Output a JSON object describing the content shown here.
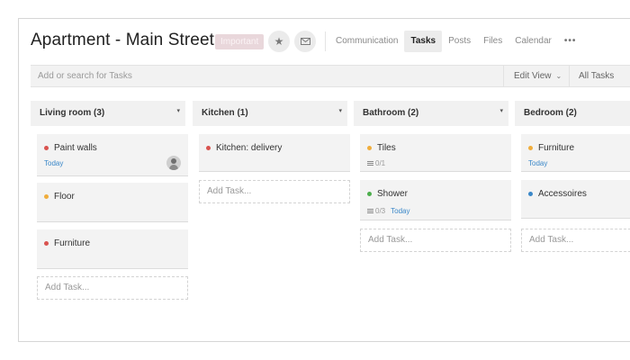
{
  "header": {
    "title": "Apartment - Main Street ...",
    "badge": "Important",
    "star_icon": "star-icon",
    "mail_icon": "mail-icon",
    "tabs": [
      {
        "label": "Communication",
        "active": false
      },
      {
        "label": "Tasks",
        "active": true
      },
      {
        "label": "Posts",
        "active": false
      },
      {
        "label": "Files",
        "active": false
      },
      {
        "label": "Calendar",
        "active": false
      }
    ],
    "more_label": "•••"
  },
  "toolbar": {
    "search_placeholder": "Add or search for Tasks",
    "edit_view_label": "Edit View",
    "all_tasks_label": "All Tasks"
  },
  "columns": [
    {
      "title": "Living room (3)",
      "cards": [
        {
          "title": "Paint walls",
          "dot": "red",
          "meta": "Today",
          "avatar": true
        },
        {
          "title": "Floor",
          "dot": "orange"
        },
        {
          "title": "Furniture",
          "dot": "red"
        }
      ],
      "add_label": "Add Task..."
    },
    {
      "title": "Kitchen (1)",
      "cards": [
        {
          "title": "Kitchen: delivery",
          "dot": "red"
        }
      ],
      "add_label": "Add Task..."
    },
    {
      "title": "Bathroom (2)",
      "cards": [
        {
          "title": "Tiles",
          "dot": "orange",
          "checklist": "0/1"
        },
        {
          "title": "Shower",
          "dot": "green",
          "checklist": "0/3",
          "meta": "Today"
        }
      ],
      "add_label": "Add Task..."
    },
    {
      "title": "Bedroom (2)",
      "cards": [
        {
          "title": "Furniture",
          "dot": "orange",
          "meta": "Today"
        },
        {
          "title": "Accessoires",
          "dot": "blue"
        }
      ],
      "add_label": "Add Task..."
    }
  ],
  "colors": {
    "accent_blue": "#3a87c8",
    "dot_red": "#d9534f",
    "dot_orange": "#f0ad3c",
    "dot_green": "#4cae4c"
  }
}
